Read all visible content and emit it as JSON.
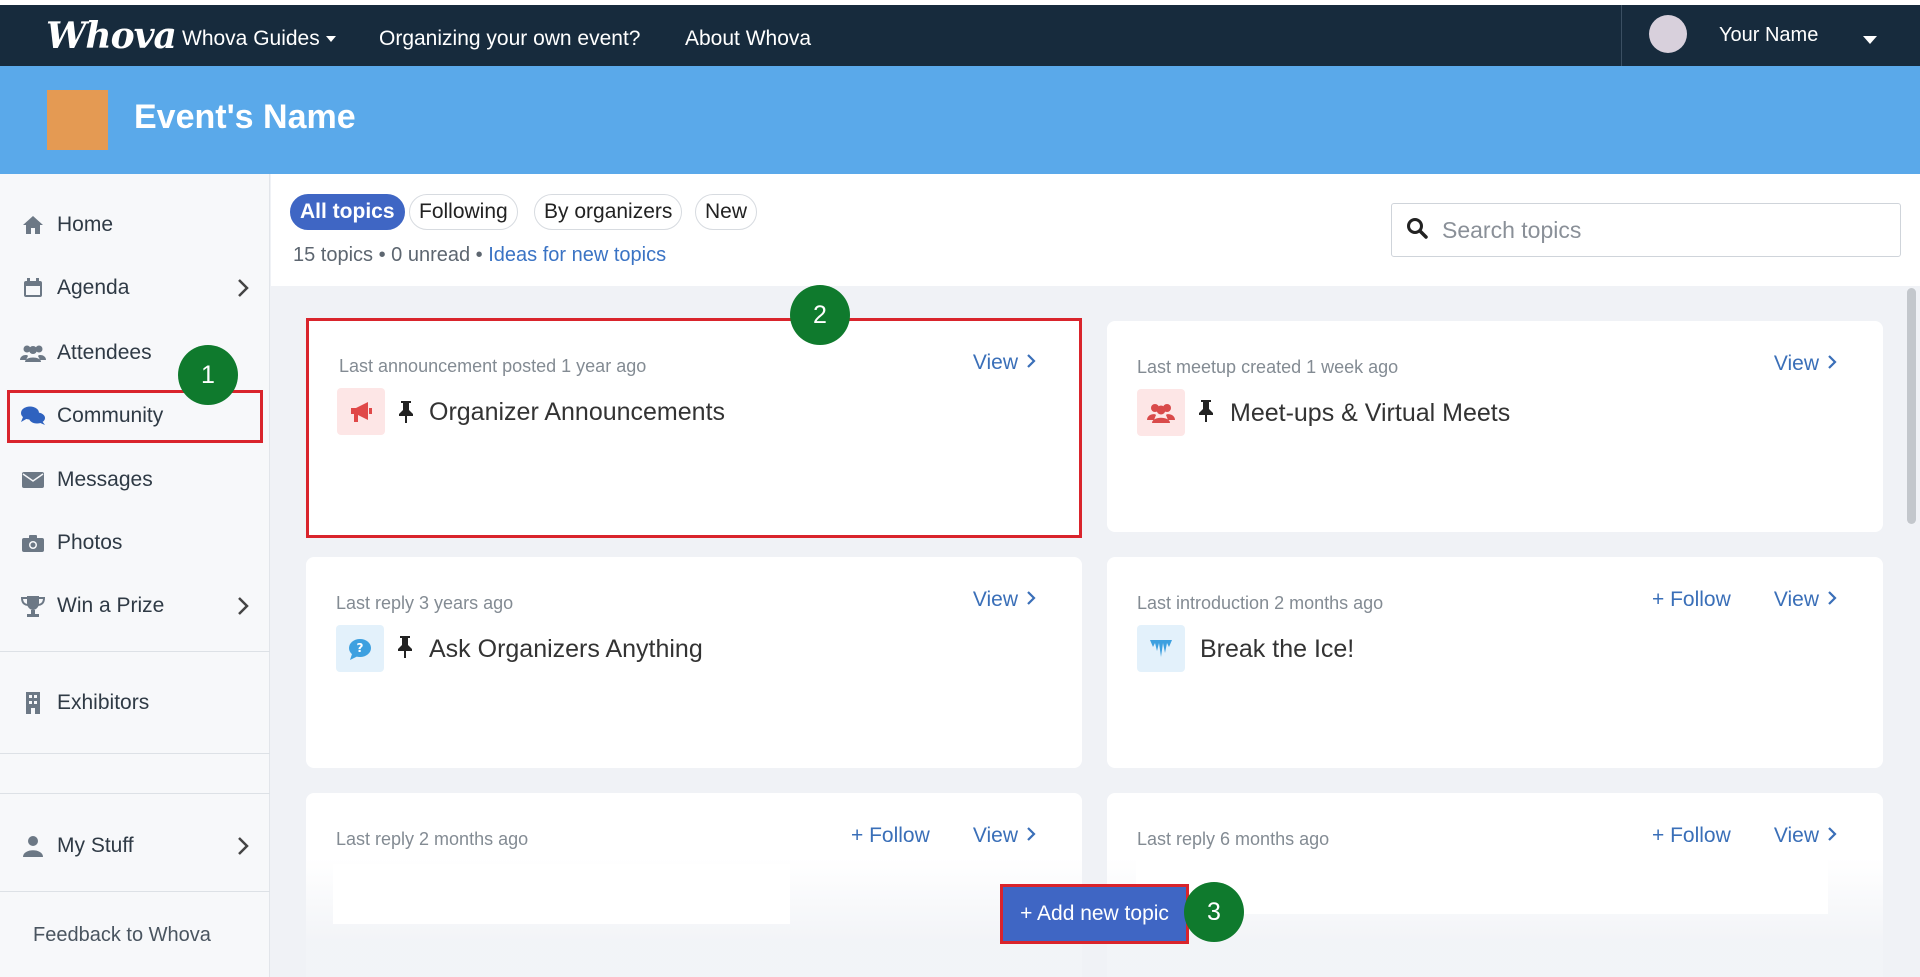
{
  "nav": {
    "logo": "Whova",
    "items": [
      "Whova Guides",
      "Organizing your own event?",
      "About Whova"
    ],
    "user_name": "Your Name"
  },
  "event": {
    "name": "Event's Name"
  },
  "sidebar": {
    "items": [
      {
        "label": "Home",
        "icon": "home-icon"
      },
      {
        "label": "Agenda",
        "icon": "calendar-icon"
      },
      {
        "label": "Attendees",
        "icon": "users-icon"
      },
      {
        "label": "Community",
        "icon": "comments-icon"
      },
      {
        "label": "Messages",
        "icon": "envelope-icon"
      },
      {
        "label": "Photos",
        "icon": "camera-icon"
      },
      {
        "label": "Win a Prize",
        "icon": "trophy-icon"
      },
      {
        "label": "Exhibitors",
        "icon": "building-icon"
      },
      {
        "label": "My Stuff",
        "icon": "user-icon"
      }
    ],
    "feedback": "Feedback to Whova"
  },
  "tabs": [
    "All topics",
    "Following",
    "By organizers",
    "New"
  ],
  "counts": {
    "text": "15 topics • 0 unread •",
    "link": "Ideas for new topics"
  },
  "search": {
    "placeholder": "Search topics"
  },
  "cards": [
    {
      "meta": "Last announcement posted 1 year ago",
      "title": "Organizer Announcements",
      "view": "View"
    },
    {
      "meta": "Last meetup created 1 week ago",
      "title": "Meet-ups & Virtual Meets",
      "view": "View"
    },
    {
      "meta": "Last reply 3 years ago",
      "title": "Ask Organizers Anything",
      "view": "View"
    },
    {
      "meta": "Last introduction 2 months ago",
      "title": "Break the Ice!",
      "view": "View",
      "follow": "+ Follow"
    },
    {
      "meta": "Last reply 2 months ago",
      "view": "View",
      "follow": "+ Follow"
    },
    {
      "meta": "Last reply 6 months ago",
      "view": "View",
      "follow": "+ Follow"
    }
  ],
  "add_button": "+ Add new topic",
  "badges": [
    "1",
    "2",
    "3"
  ],
  "colors": {
    "accent": "#3f66c4",
    "nav_bg": "#172b3d",
    "banner_bg": "#5aa9ea",
    "highlight": "#d9242c",
    "badge": "#0f7a2d"
  }
}
